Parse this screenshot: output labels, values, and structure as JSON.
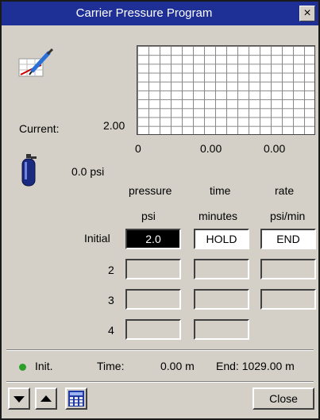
{
  "window": {
    "title": "Carrier Pressure Program",
    "close_glyph": "×"
  },
  "plot": {
    "current_label": "Current:",
    "y_label": "2.00",
    "x_ticks": [
      "0",
      "0.00",
      "0.00"
    ]
  },
  "reading": {
    "value": "0.0 psi"
  },
  "table": {
    "headers": [
      {
        "top": "pressure",
        "unit": "psi"
      },
      {
        "top": "time",
        "unit": "minutes"
      },
      {
        "top": "rate",
        "unit": "psi/min"
      }
    ],
    "rows": [
      {
        "label": "Initial",
        "pressure": "2.0",
        "time": "HOLD",
        "rate": "END"
      },
      {
        "label": "2",
        "pressure": "",
        "time": "",
        "rate": ""
      },
      {
        "label": "3",
        "pressure": "",
        "time": "",
        "rate": ""
      },
      {
        "label": "4",
        "pressure": "",
        "time": ""
      }
    ]
  },
  "status": {
    "state": "Init.",
    "time_label": "Time:",
    "time_value": "0.00 m",
    "end_text": "End: 1029.00 m",
    "led_color": "#2aa02a"
  },
  "buttons": {
    "down": "down-arrow-icon",
    "up": "up-arrow-icon",
    "calc": "calculator-icon",
    "close_label": "Close"
  }
}
